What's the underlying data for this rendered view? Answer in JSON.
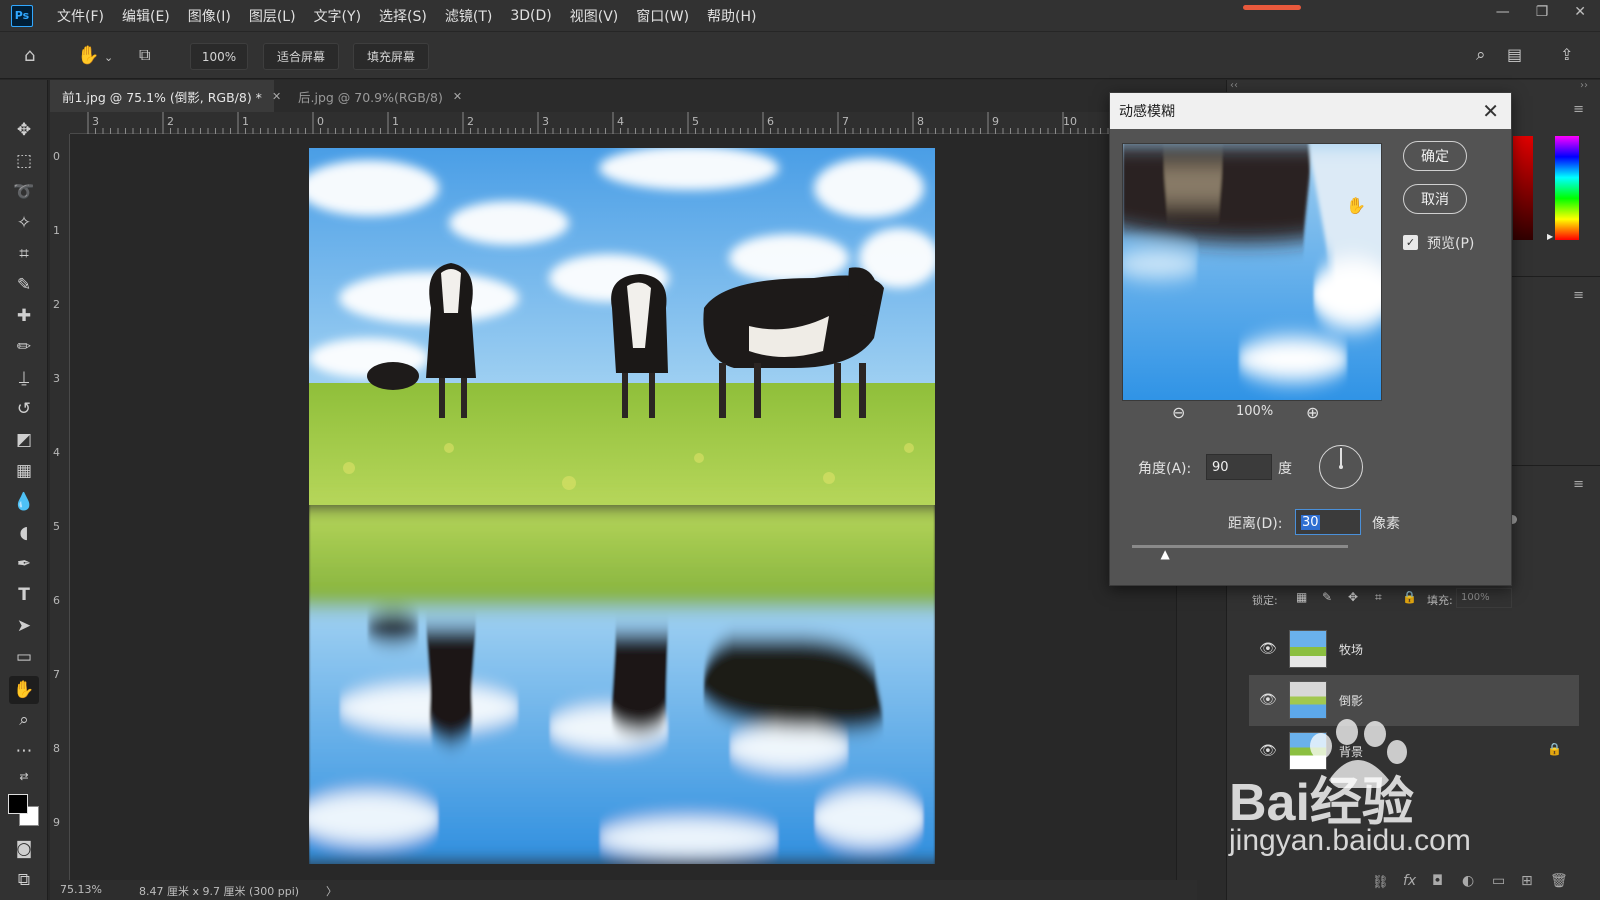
{
  "app": {
    "logo": "Ps"
  },
  "menu": [
    "文件(F)",
    "编辑(E)",
    "图像(I)",
    "图层(L)",
    "文字(Y)",
    "选择(S)",
    "滤镜(T)",
    "3D(D)",
    "视图(V)",
    "窗口(W)",
    "帮助(H)"
  ],
  "options": {
    "zoom_value": "100%",
    "fit_screen": "适合屏幕",
    "fill_screen": "填充屏幕"
  },
  "tabs": [
    {
      "label": "前1.jpg @ 75.1% (倒影, RGB/8) *",
      "close": "✕"
    },
    {
      "label": "后.jpg @ 70.9%(RGB/8)",
      "close": "✕"
    }
  ],
  "ruler_h": [
    "3",
    "2",
    "1",
    "0",
    "1",
    "2",
    "3",
    "4",
    "5",
    "6",
    "7",
    "8",
    "9",
    "10"
  ],
  "ruler_v": [
    "0",
    "1",
    "2",
    "3",
    "4",
    "5",
    "6",
    "7",
    "8",
    "9"
  ],
  "status": {
    "zoom": "75.13%",
    "doc_size": "8.47 厘米 x 9.7 厘米 (300 ppi)",
    "arrow": "〉"
  },
  "dialog": {
    "title": "动感模糊",
    "ok": "确定",
    "cancel": "取消",
    "preview_label": "预览(P)",
    "preview_checked": true,
    "preview_zoom": "100%",
    "angle_label": "角度(A):",
    "angle_value": "90",
    "angle_unit": "度",
    "distance_label": "距离(D):",
    "distance_value": "30",
    "distance_unit": "像素",
    "distance_slider_fraction": 0.16
  },
  "layers_panel": {
    "lock_label": "锁定:",
    "fill_label": "填充:",
    "fill_value": "100%",
    "layers": [
      {
        "name": "牧场",
        "visible": true,
        "selected": false,
        "locked": false
      },
      {
        "name": "倒影",
        "visible": true,
        "selected": true,
        "locked": false
      },
      {
        "name": "背景",
        "visible": true,
        "selected": false,
        "locked": true
      }
    ]
  },
  "watermark": {
    "brand": "Bai经验",
    "url": "jingyan.baidu.com"
  },
  "colors": {
    "accent": "#31a8ff",
    "panel": "#323232",
    "canvas": "#282828",
    "dialog": "#535353"
  }
}
